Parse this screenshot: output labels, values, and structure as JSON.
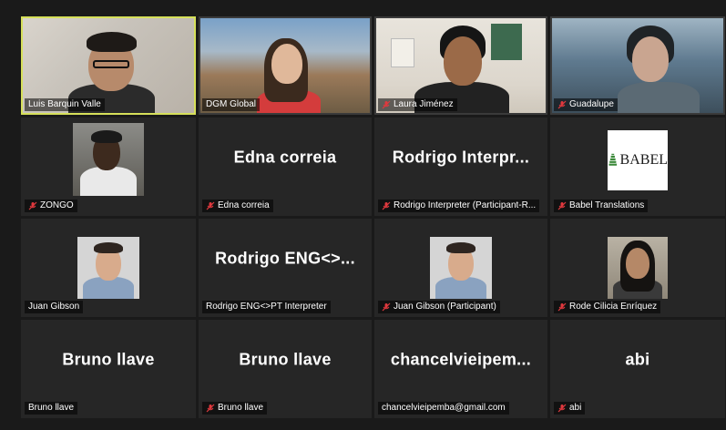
{
  "tiles": [
    {
      "name": "Luis Barquin Valle",
      "muted": false,
      "active": true,
      "display": "video"
    },
    {
      "name": "DGM Global",
      "muted": false,
      "active": false,
      "display": "video"
    },
    {
      "name": "Laura Jiménez",
      "muted": true,
      "active": false,
      "display": "video"
    },
    {
      "name": "Guadalupe",
      "muted": true,
      "active": false,
      "display": "video"
    },
    {
      "name": "ZONGO",
      "muted": true,
      "active": false,
      "display": "photo"
    },
    {
      "name": "Edna correia",
      "muted": true,
      "active": false,
      "display": "name",
      "center": "Edna correia"
    },
    {
      "name": "Rodrigo Interpreter (Participant-R...",
      "muted": true,
      "active": false,
      "display": "name",
      "center": "Rodrigo  Interpr..."
    },
    {
      "name": "Babel Translations",
      "muted": true,
      "active": false,
      "display": "logo",
      "logo_text": "BABEL"
    },
    {
      "name": "Juan Gibson",
      "muted": false,
      "active": false,
      "display": "photo"
    },
    {
      "name": "Rodrigo ENG<>PT Interpreter",
      "muted": false,
      "active": false,
      "display": "name",
      "center": "Rodrigo  ENG<>..."
    },
    {
      "name": "Juan Gibson (Participant)",
      "muted": true,
      "active": false,
      "display": "photo"
    },
    {
      "name": "Rode Cilicia Enríquez",
      "muted": true,
      "active": false,
      "display": "photo"
    },
    {
      "name": "Bruno llave",
      "muted": false,
      "active": false,
      "display": "name",
      "center": "Bruno llave"
    },
    {
      "name": "Bruno llave",
      "muted": true,
      "active": false,
      "display": "name",
      "center": "Bruno llave"
    },
    {
      "name": "chancelvieipemba@gmail.com",
      "muted": false,
      "active": false,
      "display": "name",
      "center": "chancelvieipem..."
    },
    {
      "name": "abi",
      "muted": true,
      "active": false,
      "display": "name",
      "center": "abi"
    }
  ],
  "colors": {
    "active_border": "#d6e05a",
    "muted_icon": "#e0393e",
    "tile_bg": "#262626"
  },
  "icons": {
    "muted": "mic-muted-icon"
  }
}
